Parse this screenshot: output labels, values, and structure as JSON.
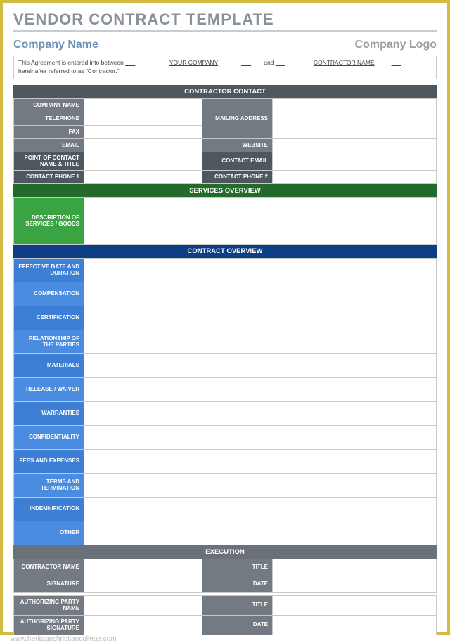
{
  "title": "VENDOR CONTRACT TEMPLATE",
  "company_name_label": "Company Name",
  "company_logo_label": "Company Logo",
  "agreement": {
    "prefix": "This Agreement is entered into between ",
    "your_company": "YOUR COMPANY",
    "middle": " and ",
    "contractor": "CONTRACTOR NAME",
    "suffix_line2": "hereinafter referred to as \"Contractor.\""
  },
  "contractor_contact": {
    "header": "CONTRACTOR CONTACT",
    "left": [
      "COMPANY NAME",
      "TELEPHONE",
      "FAX",
      "EMAIL",
      "POINT OF CONTACT NAME & TITLE",
      "CONTACT PHONE 1"
    ],
    "right": [
      "MAILING ADDRESS",
      "WEBSITE",
      "CONTACT EMAIL",
      "CONTACT PHONE 2"
    ]
  },
  "services": {
    "header": "SERVICES OVERVIEW",
    "label": "DESCRIPTION OF SERVICES / GOODS"
  },
  "contract": {
    "header": "CONTRACT OVERVIEW",
    "rows": [
      "EFFECTIVE DATE AND DURATION",
      "COMPENSATION",
      "CERTIFICATION",
      "RELATIONSHIP OF THE PARTIES",
      "MATERIALS",
      "RELEASE / WAIVER",
      "WARRANTIES",
      "CONFIDENTIALITY",
      "FEES AND EXPENSES",
      "TERMS AND TERMINATION",
      "INDEMNIFICATION",
      "OTHER"
    ]
  },
  "execution": {
    "header": "EXECUTION",
    "rows": [
      {
        "left": "CONTRACTOR NAME",
        "right": "TITLE"
      },
      {
        "left": "SIGNATURE",
        "right": "DATE"
      },
      {
        "left": "AUTHORIZING PARTY NAME",
        "right": "TITLE"
      },
      {
        "left": "AUTHORIZING PARTY SIGNATURE",
        "right": "DATE"
      }
    ]
  },
  "watermark": "www.heritagechristiancollege.com"
}
